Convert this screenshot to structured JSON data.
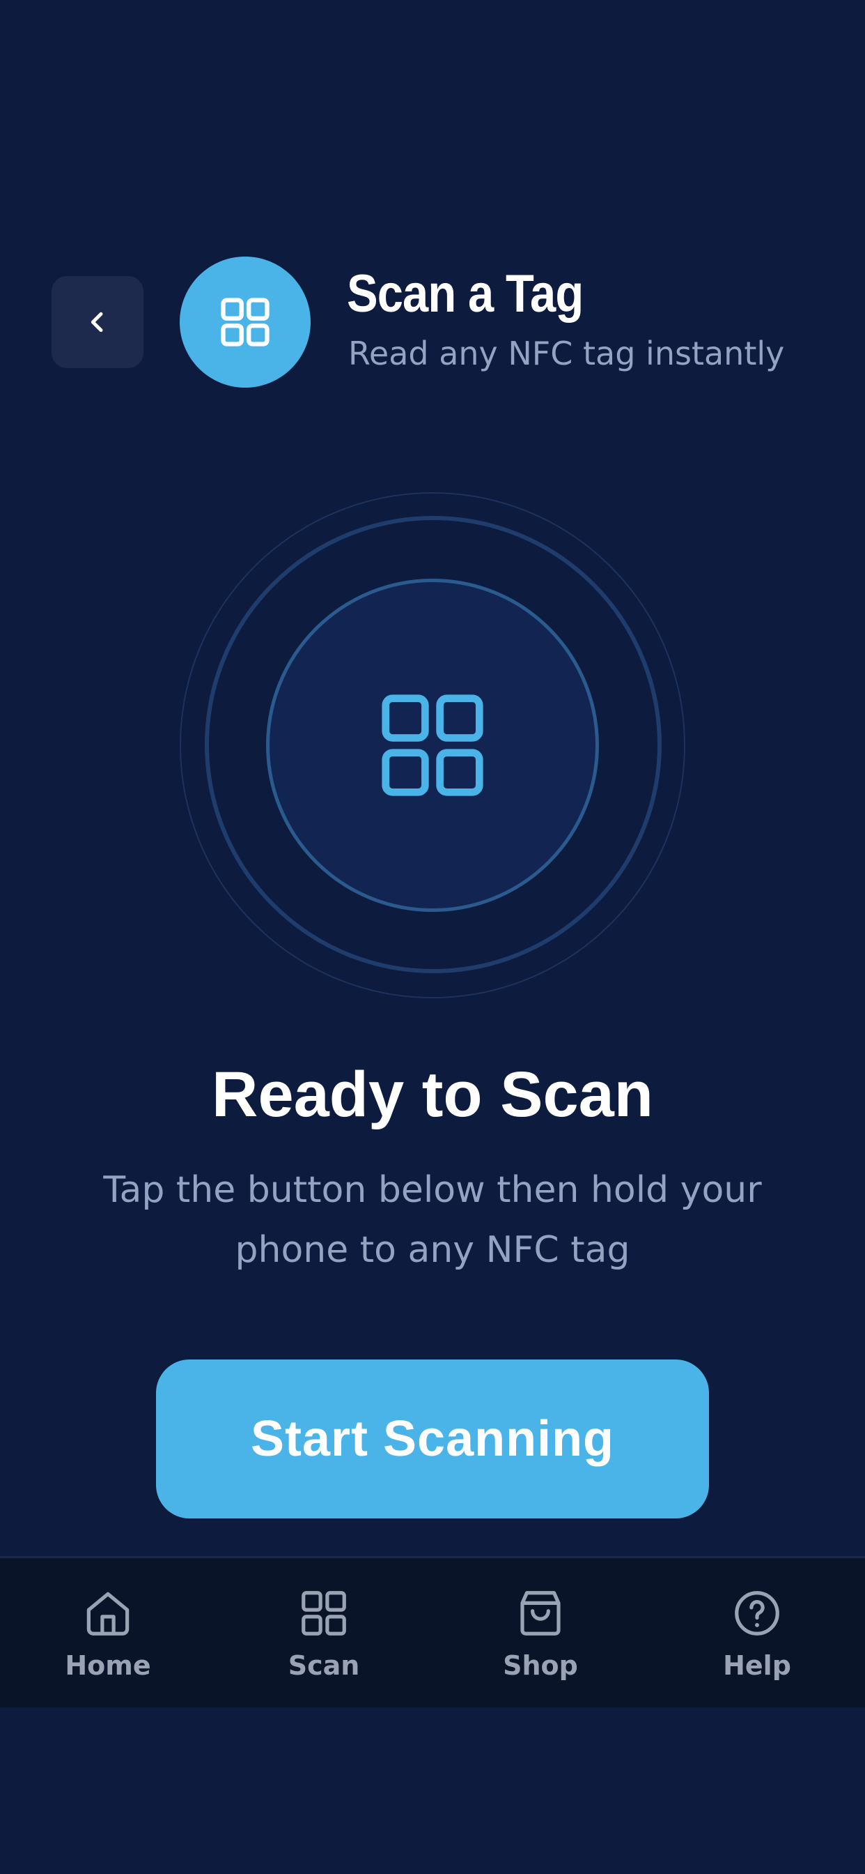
{
  "header": {
    "back_icon": "chevron-left-icon",
    "badge_icon": "grid-icon",
    "title": "Scan a Tag",
    "subtitle": "Read any NFC tag instantly"
  },
  "scanner": {
    "icon": "grid-icon"
  },
  "status": {
    "title": "Ready to Scan",
    "description": "Tap the button below then hold your phone to any NFC tag"
  },
  "cta": {
    "label": "Start Scanning"
  },
  "nav": {
    "items": [
      {
        "label": "Home",
        "icon": "home-icon"
      },
      {
        "label": "Scan",
        "icon": "grid-icon"
      },
      {
        "label": "Shop",
        "icon": "shopping-bag-icon"
      },
      {
        "label": "Help",
        "icon": "help-circle-icon"
      }
    ]
  },
  "colors": {
    "background": "#0d1b3e",
    "accent": "#4ab3e8",
    "muted_text": "#93a3c2",
    "nav_background": "#0a1428"
  }
}
